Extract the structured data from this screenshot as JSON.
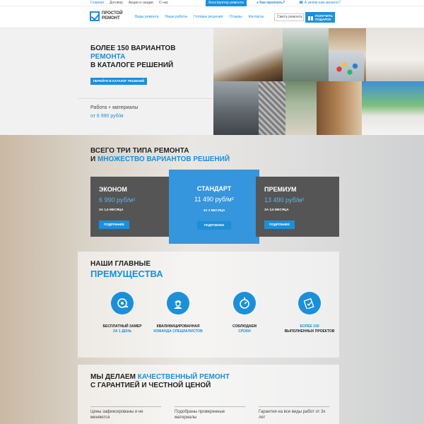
{
  "topbar": {
    "links": [
      "Главная",
      "Договор",
      "Акции и скидки",
      "О нас"
    ],
    "constructor": "Конструктор ремонта",
    "how": "Как проехать?",
    "why": "А зачем нам звонить?"
  },
  "header": {
    "logo_line1": "ПРОСТОЙ",
    "logo_line2": "РЕМОНТ",
    "nav": [
      "Виды ремонта",
      "Наши работы",
      "Готовые решения",
      "Отзывы",
      "Контакты"
    ],
    "search_value": "Смета ремонта",
    "gift_line1": "ПОЛУЧИТЬ",
    "gift_line2": "ПОДАРОК"
  },
  "hero": {
    "title_line1": "БОЛЕЕ 150 ВАРИАНТОВ",
    "title_line2": "РЕМОНТА",
    "title_line3": "В КАТАЛОГЕ РЕШЕНИЙ",
    "catalog_button": "ПЕРЕЙТИ В КАТАЛОГ РЕШЕНИЙ",
    "work": "Работа + материалы",
    "price": "от 6 990 руб/м"
  },
  "types": {
    "title_line1": "ВСЕГО ТРИ ТИПА РЕМОНТА",
    "title_and": "И",
    "title_line2": "МНОЖЕСТВО ВАРИАНТОВ РЕШЕНИЙ",
    "cards": [
      {
        "name": "ЭКОНОМ",
        "price": "6 990 руб/м²",
        "term": "ЗА 1,5 МЕСЯЦА",
        "button": "ПОДРОБНЕЕ"
      },
      {
        "name": "СТАНДАРТ",
        "price": "11 490 руб/м²",
        "term": "ЗА 2 МЕСЯЦА",
        "button": "ПОДРОБНЕЕ"
      },
      {
        "name": "ПРЕМИУМ",
        "price": "13 490 руб/м²",
        "term": "ЗА 2,5 МЕСЯЦА",
        "button": "ПОДРОБНЕЕ"
      }
    ]
  },
  "advantages": {
    "title_line1": "НАШИ ГЛАВНЫЕ",
    "title_line2": "ПРЕМУЩЕСТВА",
    "items": [
      {
        "icon": "tape-measure-icon",
        "line1": "БЕСПЛАТНЫЙ ЗАМЕР",
        "line2": "ЗА 1 ДЕНЬ"
      },
      {
        "icon": "worker-icon",
        "line1": "КВАЛИФИЦИРОВАННАЯ",
        "line2": "КОМАНДА СПЕЦИАЛИСТОВ"
      },
      {
        "icon": "stopwatch-icon",
        "line1": "СОБЛЮДАЕМ",
        "line2": "СРОКИ"
      },
      {
        "icon": "checklist-icon",
        "line1": "БОЛЕЕ 150",
        "line2": "ВЫПОЛНЕННЫХ ПРОЕКТОВ"
      }
    ]
  },
  "quality": {
    "title_line1_a": "МЫ ДЕЛАЕМ",
    "title_line1_b": "КАЧЕСТВЕННЫЙ РЕМОНТ",
    "title_line2": "С ГАРАНТИЕЙ И ЧЕСТНОЙ ЦЕНОЙ",
    "features": [
      "Цены зафиксированы и не меняются",
      "Подобраны проверенные материалы",
      "Гарантия на все виды работ от 3х лет"
    ]
  },
  "colors": {
    "accent": "#1c8fd9",
    "card_dark": "#555555",
    "card_mid": "#3595dd"
  }
}
